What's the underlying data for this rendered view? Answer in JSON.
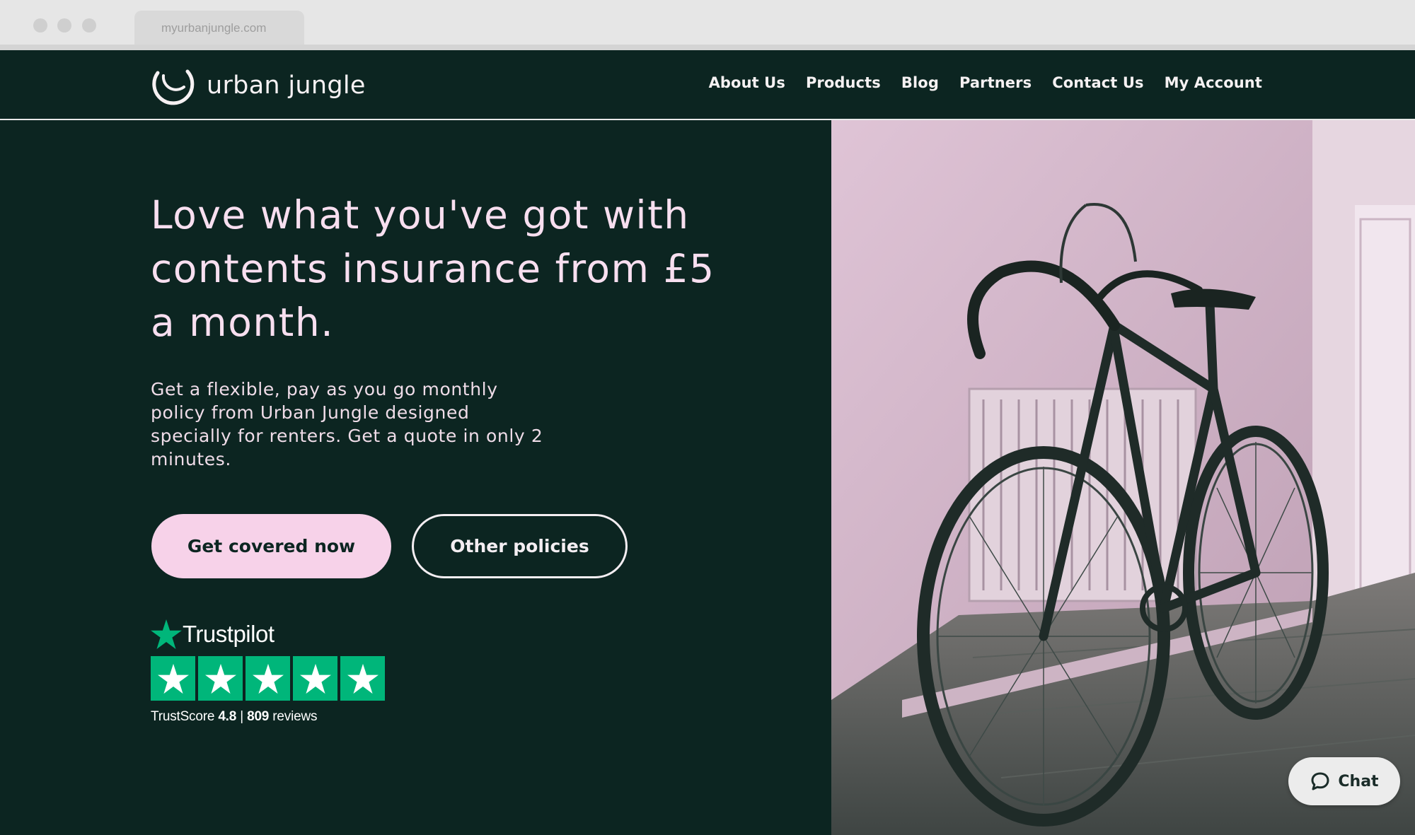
{
  "browser": {
    "url": "myurbanjungle.com"
  },
  "header": {
    "brand": "urban jungle",
    "nav": [
      "About Us",
      "Products",
      "Blog",
      "Partners",
      "Contact Us",
      "My Account"
    ]
  },
  "hero": {
    "headline": "Love what you've got with contents insurance from £5 a month.",
    "subtext": "Get a flexible, pay as you go monthly policy from Urban Jungle designed specially for renters. Get a quote in only 2 minutes.",
    "primary_cta": "Get covered now",
    "secondary_cta": "Other policies"
  },
  "trustpilot": {
    "brand": "Trustpilot",
    "stars": 5,
    "score_label": "TrustScore",
    "score": "4.8",
    "separator": "|",
    "review_count": "809",
    "reviews_label": "reviews"
  },
  "chat": {
    "label": "Chat"
  },
  "colors": {
    "background": "#0c2521",
    "accent_pink": "#f7d2e9",
    "trustpilot_green": "#00b67a"
  }
}
